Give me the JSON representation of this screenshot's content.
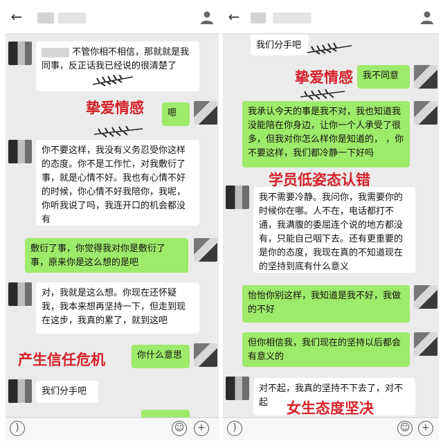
{
  "left": {
    "messages": {
      "m1": "不管你相不相信，那就就是我同事，反正话我已经说的很清楚了",
      "m2": "嗯",
      "m3": "你不要这样，我没有义务忍受你这样的态度。你不是工作忙，对我敷衍了事，就是心情不好。我也有心情不好的时候，你心情不好我陪你，我呢，你听我说了吗，我连开口的机会都没有",
      "m4": "敷衍了事，你觉得我对你是敷衍了事，原来你是这么想的是吧",
      "m5": "对，我就是这么想。你现在还怀疑我，我本来想再坚持一下，但走到现在这步，我真的累了，就到这吧",
      "m6": "你什么意思",
      "m7": "我们分手吧"
    },
    "labels": {
      "label1": "挚爱情感",
      "label2": "产生信任危机"
    }
  },
  "right": {
    "messages": {
      "m1": "我们分手吧",
      "m2": "我不同意",
      "m3": "我承认今天的事是我不对，我也知道我没能陪在你身边，让你一个人承受了很多，但我对你怎么样你是知道的，    ，你不要这样，我们都冷静一下好吗",
      "m4": "我不需要冷静。我问你，我需要你的时候你在哪。人不在，电话都打不通，我满腹的委屈连个说的地方都没有，只能自己咽下去。还有更重要的是你的态度，我现在真的不知道现在的坚持到底有什么意义",
      "m5": "怡怡你别这样，我知道是我不好，我做的不好",
      "m6": "但你相信我，我们现在的坚持以后都会有意义的",
      "m7": "对不起，我真的坚持不下去了，对不起"
    },
    "labels": {
      "label1": "挚爱情感",
      "label2": "学员低姿态认错",
      "label3": "女生态度坚决"
    }
  },
  "icons": {
    "back": "back-arrow-icon",
    "contact": "person-icon",
    "voice": "voice-icon",
    "emoji": "emoji-icon",
    "plus": "plus-icon"
  },
  "colors": {
    "sent_bubble": "#9eea6a",
    "recv_bubble": "#ffffff",
    "chat_bg": "#ebebeb",
    "overlay_red": "#d6212a"
  }
}
